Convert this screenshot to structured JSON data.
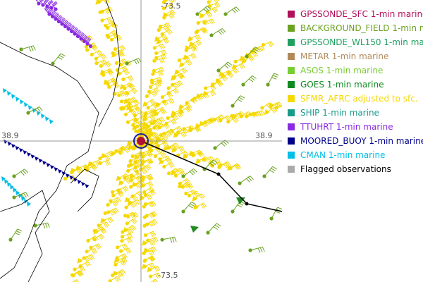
{
  "map": {
    "grid_labels": {
      "lon_top": "-73.5",
      "lat_left": "38.9",
      "lat_right": "38.9",
      "lon_bottom": "-73.5"
    },
    "colors": {
      "coast": "#000000",
      "grid": "#999999",
      "sfmr": "#f5d800",
      "buoy": "#00008b",
      "cman": "#00bfe6",
      "ttuhrt": "#8a2be2",
      "background": "#6aa121",
      "goes": "#228b22",
      "track": "#000000",
      "center": "#b01030",
      "center_ring": "#1a1aa0"
    },
    "icons": {
      "storm_center": "storm-center-icon",
      "track_point": "track-point-icon"
    }
  },
  "legend": {
    "items": [
      {
        "label": "GPSSONDE_SFC 1-min marine",
        "swatch": "#b0105c",
        "text_color": "#b0105c"
      },
      {
        "label": "BACKGROUND_FIELD 1-min m",
        "swatch": "#6aa121",
        "text_color": "#6aa121"
      },
      {
        "label": "GPSSONDE_WL150 1-min mar",
        "swatch": "#20a060",
        "text_color": "#20a060"
      },
      {
        "label": "METAR 1-min marine",
        "swatch": "#b08a5a",
        "text_color": "#b08a5a"
      },
      {
        "label": "ASOS 1-min marine",
        "swatch": "#7acd32",
        "text_color": "#7acd32"
      },
      {
        "label": "GOES 1-min marine",
        "swatch": "#108a20",
        "text_color": "#108a20"
      },
      {
        "label": "SFMR_AFRC adjusted to sfc.",
        "swatch": "#f5d800",
        "text_color": "#f5d800"
      },
      {
        "label": "SHIP 1-min marine",
        "swatch": "#1a9a8a",
        "text_color": "#1a9a8a"
      },
      {
        "label": "TTUHRT 1-min marine",
        "swatch": "#8a2be2",
        "text_color": "#8a2be2"
      },
      {
        "label": "MOORED_BUOY 1-min marine",
        "swatch": "#00008b",
        "text_color": "#00008b"
      },
      {
        "label": "CMAN 1-min marine",
        "swatch": "#00bfe6",
        "text_color": "#00bfe6"
      },
      {
        "label": "Flagged observations",
        "swatch": "#aaaaaa",
        "text_color": "#000000"
      }
    ]
  }
}
